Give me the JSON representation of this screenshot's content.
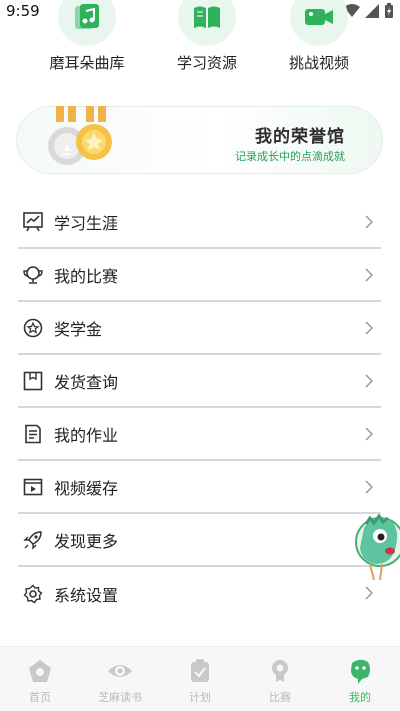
{
  "status_bar": {
    "time": "9:59"
  },
  "shortcuts": [
    {
      "label": "磨耳朵曲库",
      "icon": "music-cards-icon"
    },
    {
      "label": "学习资源",
      "icon": "book-icon"
    },
    {
      "label": "挑战视频",
      "icon": "video-camera-icon"
    }
  ],
  "honor": {
    "title": "我的荣誉馆",
    "subtitle": "记录成长中的点滴成就"
  },
  "menu": [
    {
      "label": "学习生涯",
      "icon": "chart-board-icon"
    },
    {
      "label": "我的比赛",
      "icon": "trophy-icon"
    },
    {
      "label": "奖学金",
      "icon": "star-circle-icon"
    },
    {
      "label": "发货查询",
      "icon": "package-icon"
    },
    {
      "label": "我的作业",
      "icon": "document-icon"
    },
    {
      "label": "视频缓存",
      "icon": "video-play-icon"
    },
    {
      "label": "发现更多",
      "icon": "rocket-icon"
    },
    {
      "label": "系统设置",
      "icon": "gear-icon"
    }
  ],
  "tabbar": [
    {
      "label": "首页",
      "icon": "home-icon",
      "active": false
    },
    {
      "label": "芝麻读书",
      "icon": "eye-book-icon",
      "active": false
    },
    {
      "label": "计划",
      "icon": "plan-icon",
      "active": false
    },
    {
      "label": "比赛",
      "icon": "medal-icon",
      "active": false
    },
    {
      "label": "我的",
      "icon": "mascot-icon",
      "active": true
    }
  ],
  "colors": {
    "accent": "#3cb46a",
    "inactive": "#b9b9b9",
    "divider": "#d7d7d7"
  }
}
